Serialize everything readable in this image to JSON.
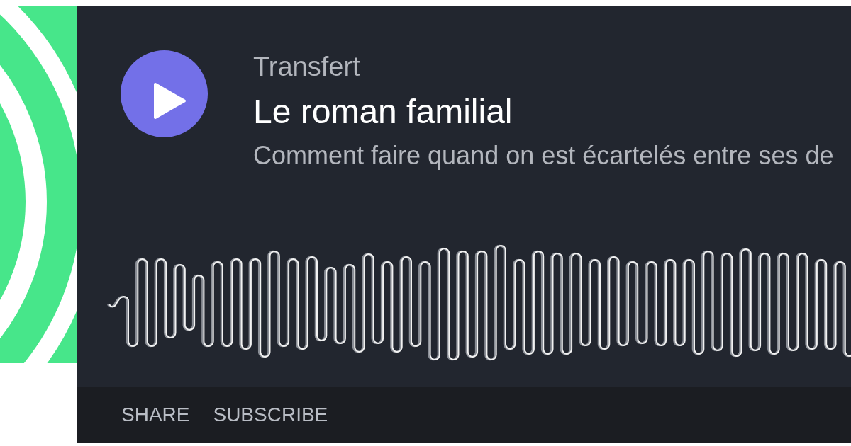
{
  "player": {
    "playing": false,
    "show_name": "Transfert",
    "episode_title": "Le roman familial",
    "description": "Comment faire quand on est écartelés entre ses de"
  },
  "footer": {
    "actions": [
      "SHARE",
      "SUBSCRIBE"
    ]
  }
}
